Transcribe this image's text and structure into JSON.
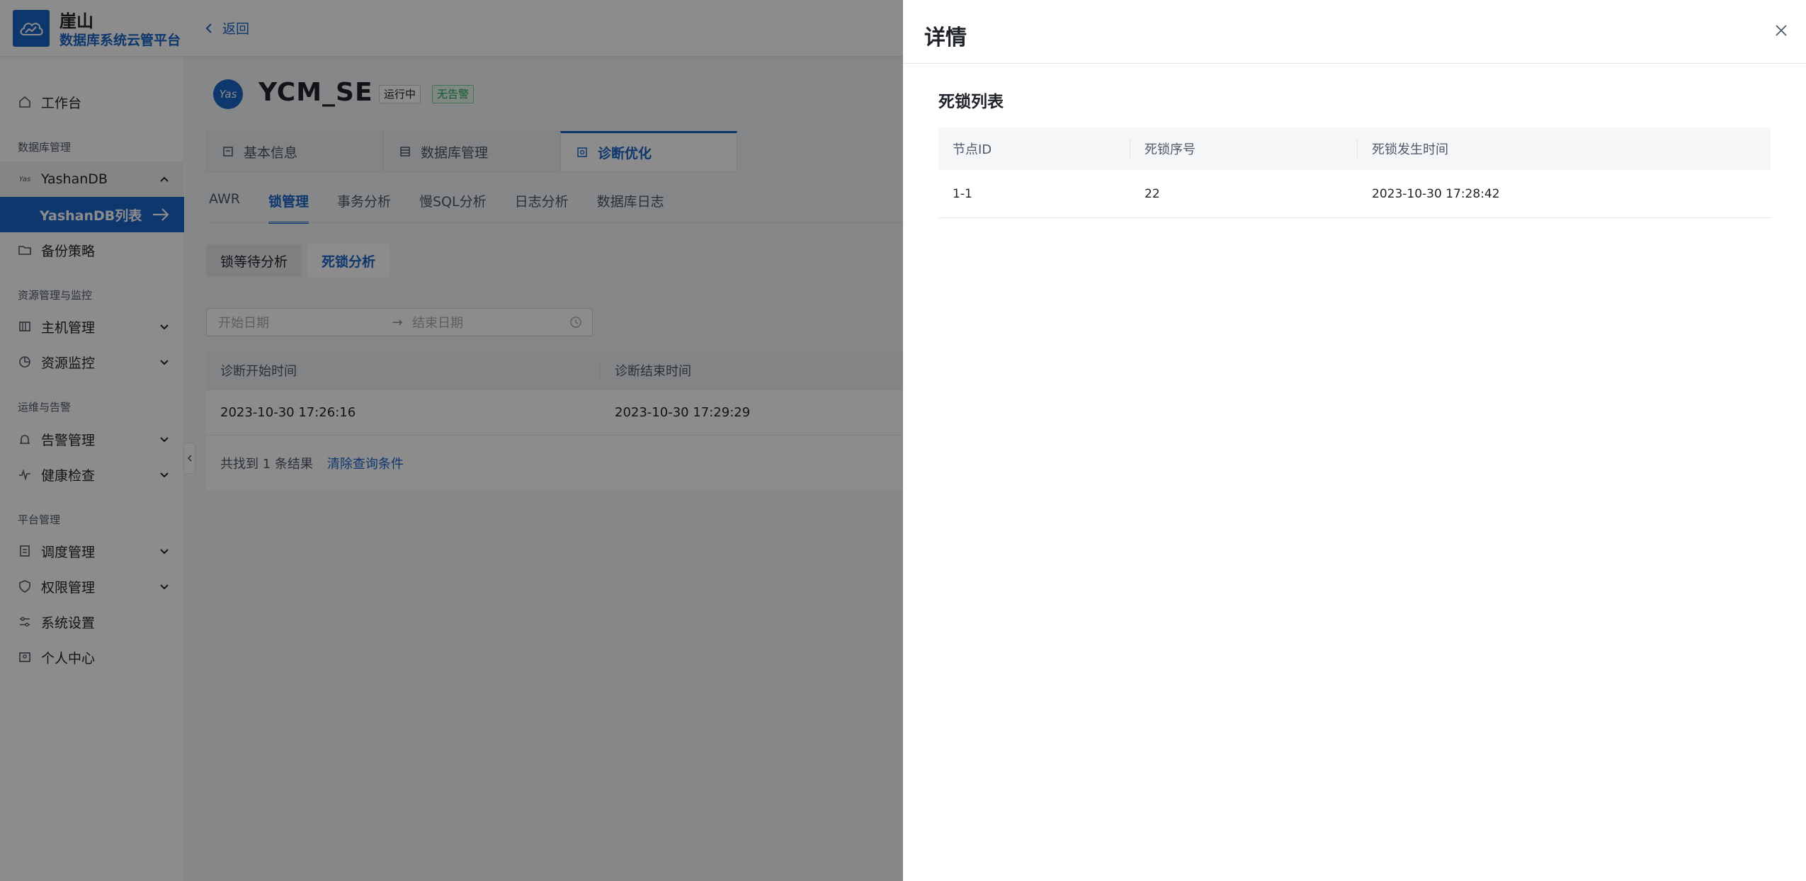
{
  "app": {
    "brand_name": "崖山",
    "brand_subtitle": "数据库系统云管平台",
    "back_label": "返回"
  },
  "sidebar": {
    "workbench": "工作台",
    "group_db": "数据库管理",
    "yashandb": "YashanDB",
    "yashandb_list": "YashanDB列表",
    "backup": "备份策略",
    "group_resource": "资源管理与监控",
    "host": "主机管理",
    "monitor": "资源监控",
    "group_ops": "运维与告警",
    "alarm": "告警管理",
    "health": "健康检查",
    "group_platform": "平台管理",
    "schedule": "调度管理",
    "permission": "权限管理",
    "settings": "系统设置",
    "profile": "个人中心"
  },
  "instance": {
    "avatar_text": "Yas",
    "name": "YCM_SE",
    "status": "运行中",
    "alarm": "无告警"
  },
  "tabs": [
    "基本信息",
    "数据库管理",
    "诊断优化"
  ],
  "subtabs": [
    "AWR",
    "锁管理",
    "事务分析",
    "慢SQL分析",
    "日志分析",
    "数据库日志"
  ],
  "segments": [
    "锁等待分析",
    "死锁分析"
  ],
  "filter": {
    "start_placeholder": "开始日期",
    "end_placeholder": "结束日期",
    "separator": "→"
  },
  "diag_table": {
    "headers": [
      "诊断开始时间",
      "诊断结束时间"
    ],
    "rows": [
      [
        "2023-10-30 17:26:16",
        "2023-10-30 17:29:29"
      ]
    ],
    "result_prefix": "共找到",
    "result_count": "1",
    "result_suffix": "条结果",
    "clear_label": "清除查询条件"
  },
  "drawer": {
    "title": "详情",
    "section_title": "死锁列表",
    "headers": [
      "节点ID",
      "死锁序号",
      "死锁发生时间"
    ],
    "rows": [
      [
        "1-1",
        "22",
        "2023-10-30 17:28:42"
      ]
    ]
  },
  "colors": {
    "primary": "#1964c7",
    "success": "#23a55a",
    "mask": "rgba(0,0,0,0.45)"
  }
}
